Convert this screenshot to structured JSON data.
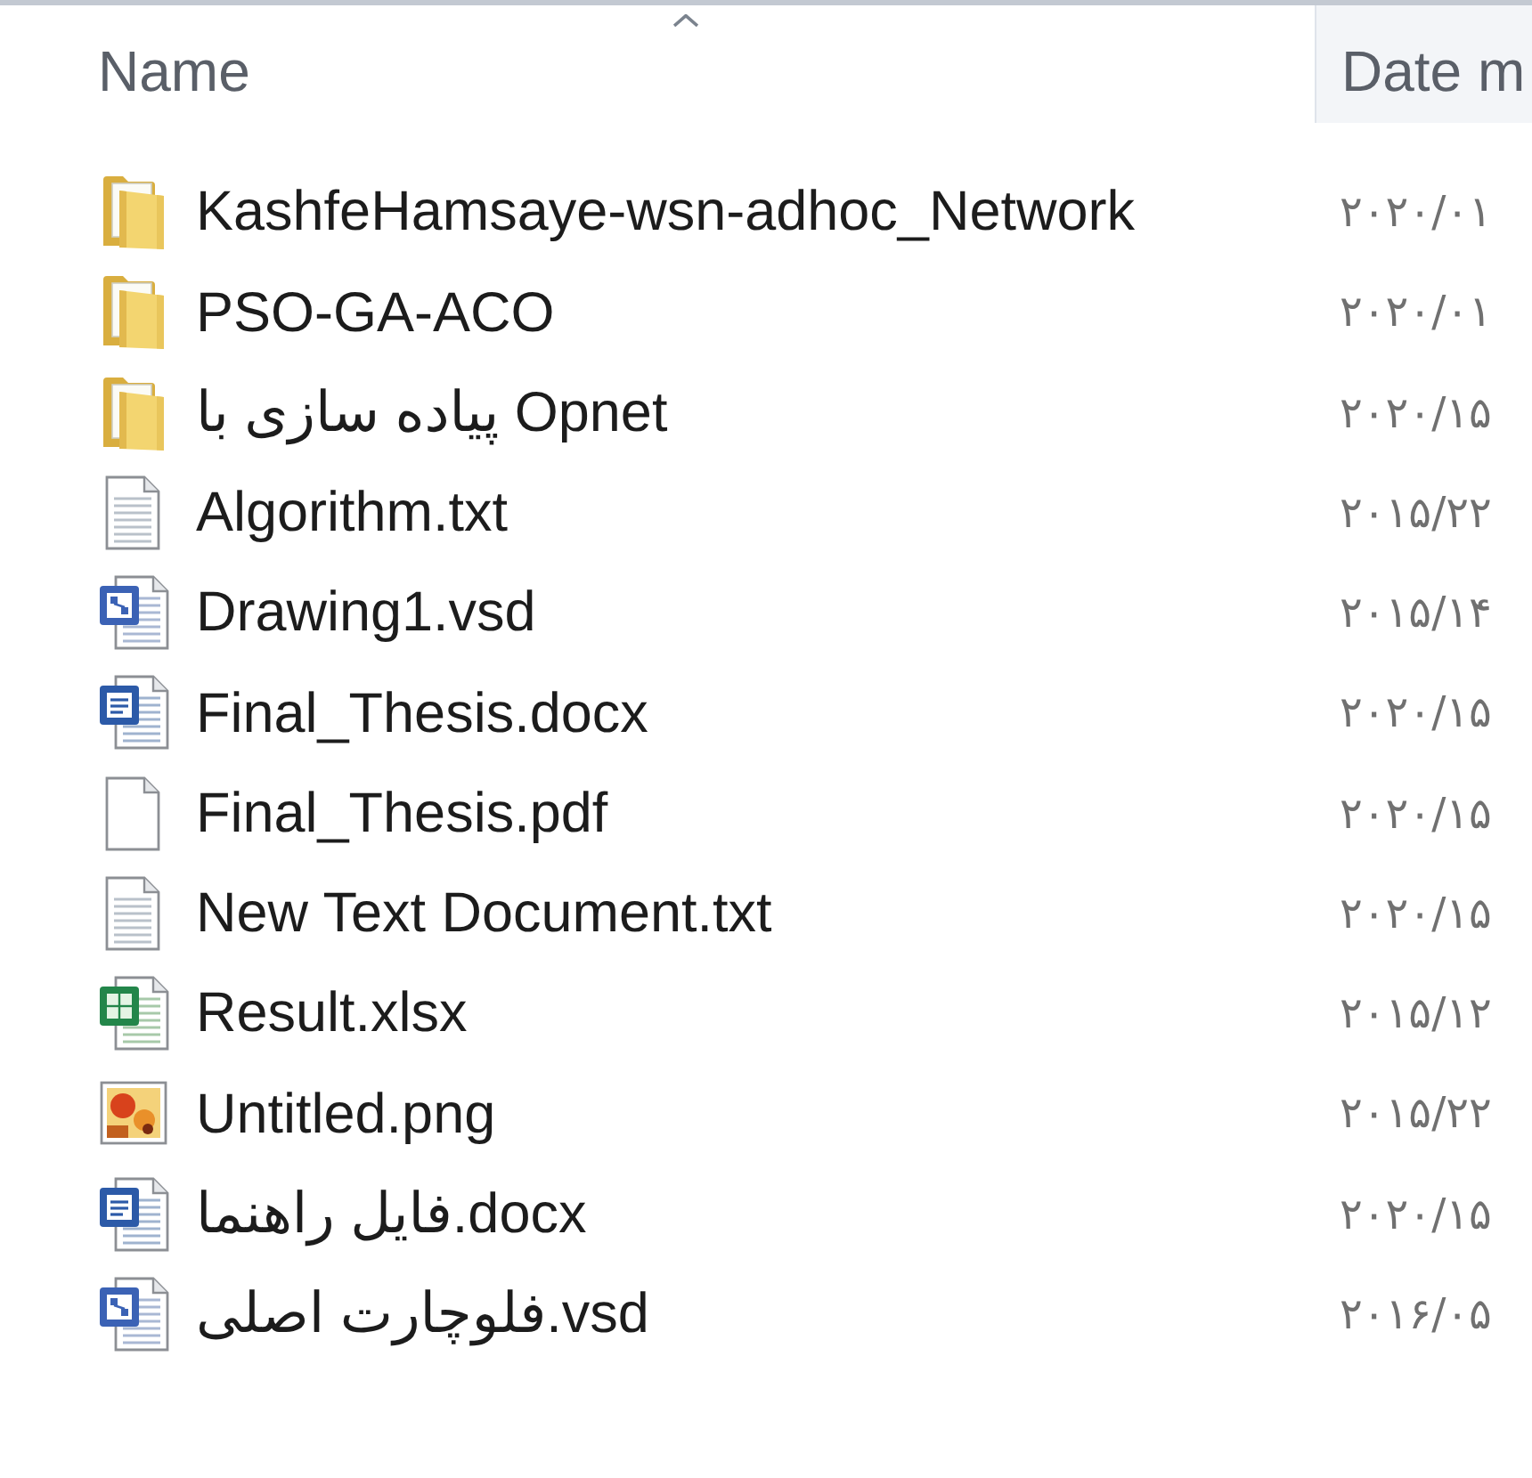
{
  "header": {
    "name_column": {
      "label": "Name",
      "sorted": true,
      "hovered": false
    },
    "date_column": {
      "label": "Date m",
      "sorted": false,
      "hovered": true
    }
  },
  "files": [
    {
      "name": "KashfeHamsaye-wsn-adhoc_Network",
      "kind": "folder",
      "date_modified": "۲۰۲۰/۰۱"
    },
    {
      "name": "PSO-GA-ACO",
      "kind": "folder",
      "date_modified": "۲۰۲۰/۰۱"
    },
    {
      "name": "پیاده سازی با Opnet",
      "kind": "folder",
      "date_modified": "۲۰۲۰/۱۵"
    },
    {
      "name": "Algorithm.txt",
      "kind": "text",
      "date_modified": "۲۰۱۵/۲۲"
    },
    {
      "name": "Drawing1.vsd",
      "kind": "diagram",
      "date_modified": "۲۰۱۵/۱۴"
    },
    {
      "name": "Final_Thesis.docx",
      "kind": "document",
      "date_modified": "۲۰۲۰/۱۵"
    },
    {
      "name": "Final_Thesis.pdf",
      "kind": "blank",
      "date_modified": "۲۰۲۰/۱۵"
    },
    {
      "name": "New Text Document.txt",
      "kind": "text",
      "date_modified": "۲۰۲۰/۱۵"
    },
    {
      "name": "Result.xlsx",
      "kind": "spreadsheet",
      "date_modified": "۲۰۱۵/۱۲"
    },
    {
      "name": "Untitled.png",
      "kind": "image",
      "date_modified": "۲۰۱۵/۲۲"
    },
    {
      "name": "فایل راهنما.docx",
      "kind": "document",
      "date_modified": "۲۰۲۰/۱۵"
    },
    {
      "name": "فلوچارت اصلی.vsd",
      "kind": "diagram",
      "date_modified": "۲۰۱۶/۰۵"
    }
  ]
}
